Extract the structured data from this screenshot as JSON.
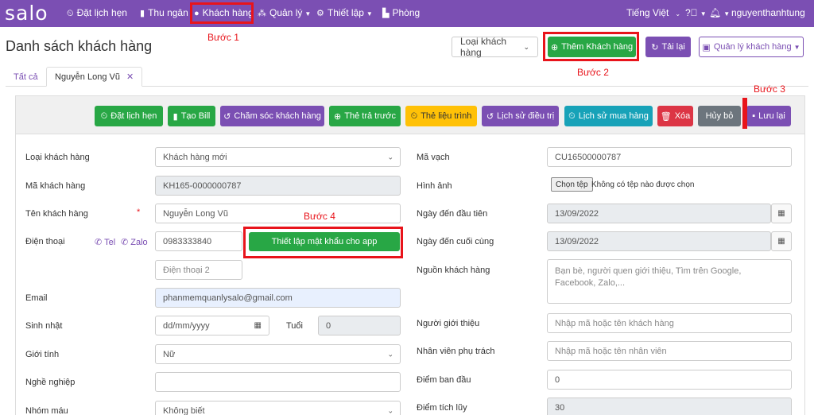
{
  "nav": {
    "logo": "salo",
    "items": [
      "Đặt lịch hẹn",
      "Thu ngân",
      "Khách hàng",
      "Quản lý",
      "Thiết lập",
      "Phòng"
    ],
    "lang": "Tiếng Việt",
    "user": "nguyenthanhtung"
  },
  "steps": {
    "s1": "Bước 1",
    "s2": "Bước 2",
    "s3": "Bước 3",
    "s4": "Bước 4"
  },
  "page": {
    "title": "Danh sách khách hàng",
    "type_select": "Loại khách hàng",
    "add": "Thêm Khách hàng",
    "reload": "Tải lại",
    "manage": "Quản lý khách hàng"
  },
  "tabs": {
    "all": "Tất cả",
    "current": "Nguyễn Long Vũ"
  },
  "toolbar": [
    "Đặt lịch hẹn",
    "Tạo Bill",
    "Chăm sóc khách hàng",
    "Thẻ trả trước",
    "Thẻ liệu trình",
    "Lịch sử điều trị",
    "Lịch sử mua hàng",
    "Xóa",
    "Hủy bỏ",
    "Lưu lại"
  ],
  "form": {
    "type_label": "Loại khách hàng",
    "type_value": "Khách hàng mới",
    "code_label": "Mã khách hàng",
    "code_value": "KH165-0000000787",
    "name_label": "Tên khách hàng",
    "req": "*",
    "name_value": "Nguyễn Long Vũ",
    "phone_label": "Điện thoại",
    "tel": "Tel",
    "zalo": "Zalo",
    "phone_value": "0983333840",
    "app_pw": "Thiết lập mật khẩu cho app",
    "phone2_placeholder": "Điện thoại 2",
    "email_label": "Email",
    "email_value": "phanmemquanlysalo@gmail.com",
    "birthday_label": "Sinh nhật",
    "birthday_placeholder": "dd/mm/yyyy",
    "age_label": "Tuổi",
    "age_value": "0",
    "gender_label": "Giới tính",
    "gender_value": "Nữ",
    "job_label": "Nghề nghiệp",
    "blood_label": "Nhóm máu",
    "blood_value": "Không biết",
    "barcode_label": "Mã vạch",
    "barcode_value": "CU16500000787",
    "image_label": "Hình ảnh",
    "file_btn": "Chọn tệp",
    "file_text": "Không có tệp nào được chọn",
    "first_label": "Ngày đến đầu tiên",
    "first_value": "13/09/2022",
    "last_label": "Ngày đến cuối cùng",
    "last_value": "13/09/2022",
    "source_label": "Nguồn khách hàng",
    "source_placeholder": "Bạn bè, người quen giới thiệu, Tìm trên Google, Facebook, Zalo,...",
    "referrer_label": "Người giới thiệu",
    "referrer_placeholder": "Nhập mã hoặc tên khách hàng",
    "staff_label": "Nhân viên phụ trách",
    "staff_placeholder": "Nhập mã hoặc tên nhân viên",
    "init_label": "Điểm ban đầu",
    "init_value": "0",
    "acc_label": "Điểm tích lũy",
    "acc_value": "30"
  }
}
